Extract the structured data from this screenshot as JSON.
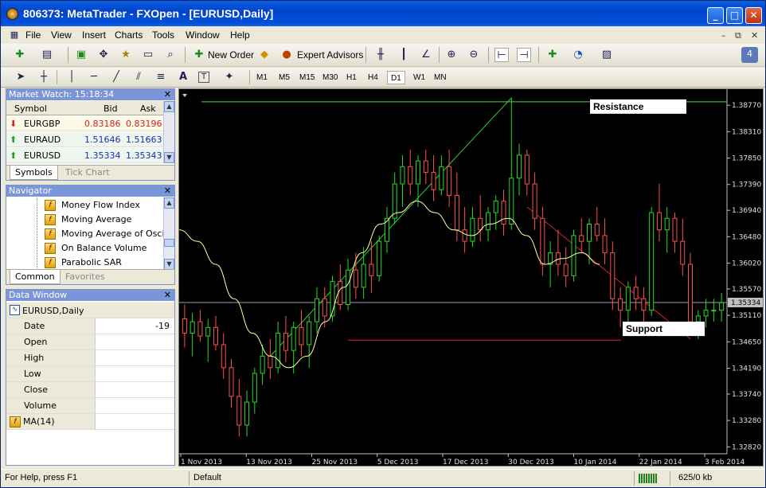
{
  "window": {
    "title": "806373: MetaTrader - FXOpen - [EURUSD,Daily]",
    "icon": "metatrader-app-icon"
  },
  "menu": [
    "File",
    "View",
    "Insert",
    "Charts",
    "Tools",
    "Window",
    "Help"
  ],
  "toolbar": {
    "new_order": "New Order",
    "expert_advisors": "Expert Advisors",
    "notification_count": "4"
  },
  "timeframes": [
    "M1",
    "M5",
    "M15",
    "M30",
    "H1",
    "H4",
    "D1",
    "W1",
    "MN"
  ],
  "selected_timeframe": "D1",
  "market_watch": {
    "title": "Market Watch: 15:18:34",
    "headers": [
      "Symbol",
      "Bid",
      "Ask"
    ],
    "rows": [
      {
        "symbol": "EURGBP",
        "bid": "0.83186",
        "ask": "0.83196",
        "dir": "down"
      },
      {
        "symbol": "EURAUD",
        "bid": "1.51646",
        "ask": "1.51663",
        "dir": "up"
      },
      {
        "symbol": "EURUSD",
        "bid": "1.35334",
        "ask": "1.35343",
        "dir": "up"
      }
    ],
    "tabs": [
      "Symbols",
      "Tick Chart"
    ]
  },
  "navigator": {
    "title": "Navigator",
    "items": [
      "Money Flow Index",
      "Moving Average",
      "Moving Average of Oscilla",
      "On Balance Volume",
      "Parabolic SAR"
    ],
    "tabs": [
      "Common",
      "Favorites"
    ]
  },
  "data_window": {
    "title": "Data Window",
    "symbol": "EURUSD,Daily",
    "rows": [
      {
        "label": "Date",
        "value": "-19"
      },
      {
        "label": "Open",
        "value": ""
      },
      {
        "label": "High",
        "value": ""
      },
      {
        "label": "Low",
        "value": ""
      },
      {
        "label": "Close",
        "value": ""
      },
      {
        "label": "Volume",
        "value": ""
      }
    ],
    "indicator": "MA(14)"
  },
  "chart_data": {
    "type": "candlestick",
    "symbol": "EURUSD",
    "timeframe": "Daily",
    "price_ticks": [
      "1.38770",
      "1.38310",
      "1.37850",
      "1.37390",
      "1.36940",
      "1.36480",
      "1.36020",
      "1.35570",
      "1.35110",
      "1.34650",
      "1.34190",
      "1.33740",
      "1.33280",
      "1.32820"
    ],
    "current_price": "1.35334",
    "date_ticks": [
      "1 Nov 2013",
      "13 Nov 2013",
      "25 Nov 2013",
      "5 Dec 2013",
      "17 Dec 2013",
      "30 Dec 2013",
      "10 Jan 2014",
      "22 Jan 2014",
      "3 Feb 2014"
    ],
    "annotations": {
      "resistance": "Resistance",
      "support": "Support"
    },
    "resistance_level": 1.3883,
    "support_level": 1.3468,
    "ylim": [
      1.327,
      1.3905
    ],
    "colors": {
      "bull": "#22dd22",
      "bear": "#ff5050",
      "ma": "#ffffa0",
      "hline": "#3fdc3f",
      "support_line": "#dc1e3c",
      "grid": "#606060",
      "price_line": "#a0a0c0"
    },
    "candles": [
      [
        1.3505,
        1.353,
        1.3455,
        1.348
      ],
      [
        1.348,
        1.3515,
        1.344,
        1.35
      ],
      [
        1.35,
        1.352,
        1.3465,
        1.3475
      ],
      [
        1.3475,
        1.3505,
        1.343,
        1.349
      ],
      [
        1.349,
        1.351,
        1.345,
        1.346
      ],
      [
        1.346,
        1.348,
        1.34,
        1.342
      ],
      [
        1.342,
        1.3435,
        1.335,
        1.337
      ],
      [
        1.337,
        1.34,
        1.33,
        1.332
      ],
      [
        1.332,
        1.338,
        1.33,
        1.336
      ],
      [
        1.336,
        1.342,
        1.334,
        1.341
      ],
      [
        1.341,
        1.346,
        1.339,
        1.344
      ],
      [
        1.344,
        1.347,
        1.34,
        1.342
      ],
      [
        1.342,
        1.35,
        1.341,
        1.348
      ],
      [
        1.348,
        1.351,
        1.343,
        1.345
      ],
      [
        1.345,
        1.35,
        1.341,
        1.349
      ],
      [
        1.349,
        1.352,
        1.344,
        1.346
      ],
      [
        1.346,
        1.351,
        1.342,
        1.35
      ],
      [
        1.35,
        1.356,
        1.348,
        1.354
      ],
      [
        1.354,
        1.356,
        1.349,
        1.351
      ],
      [
        1.351,
        1.358,
        1.35,
        1.357
      ],
      [
        1.357,
        1.36,
        1.352,
        1.353
      ],
      [
        1.353,
        1.361,
        1.352,
        1.359
      ],
      [
        1.359,
        1.362,
        1.354,
        1.356
      ],
      [
        1.356,
        1.363,
        1.354,
        1.36
      ],
      [
        1.36,
        1.364,
        1.355,
        1.358
      ],
      [
        1.358,
        1.365,
        1.357,
        1.364
      ],
      [
        1.364,
        1.37,
        1.362,
        1.368
      ],
      [
        1.368,
        1.376,
        1.367,
        1.374
      ],
      [
        1.374,
        1.379,
        1.37,
        1.377
      ],
      [
        1.377,
        1.38,
        1.372,
        1.374
      ],
      [
        1.374,
        1.379,
        1.37,
        1.378
      ],
      [
        1.378,
        1.38,
        1.374,
        1.376
      ],
      [
        1.376,
        1.379,
        1.371,
        1.373
      ],
      [
        1.373,
        1.379,
        1.372,
        1.377
      ],
      [
        1.377,
        1.38,
        1.37,
        1.372
      ],
      [
        1.372,
        1.376,
        1.364,
        1.366
      ],
      [
        1.366,
        1.37,
        1.362,
        1.364
      ],
      [
        1.364,
        1.37,
        1.363,
        1.368
      ],
      [
        1.368,
        1.372,
        1.364,
        1.366
      ],
      [
        1.366,
        1.37,
        1.364,
        1.369
      ],
      [
        1.369,
        1.372,
        1.366,
        1.371
      ],
      [
        1.371,
        1.373,
        1.365,
        1.367
      ],
      [
        1.367,
        1.389,
        1.366,
        1.375
      ],
      [
        1.375,
        1.381,
        1.372,
        1.379
      ],
      [
        1.379,
        1.38,
        1.372,
        1.374
      ],
      [
        1.374,
        1.376,
        1.366,
        1.368
      ],
      [
        1.368,
        1.37,
        1.358,
        1.36
      ],
      [
        1.36,
        1.364,
        1.356,
        1.362
      ],
      [
        1.362,
        1.366,
        1.358,
        1.36
      ],
      [
        1.36,
        1.363,
        1.356,
        1.358
      ],
      [
        1.358,
        1.366,
        1.357,
        1.365
      ],
      [
        1.365,
        1.368,
        1.362,
        1.364
      ],
      [
        1.364,
        1.368,
        1.36,
        1.367
      ],
      [
        1.367,
        1.37,
        1.364,
        1.365
      ],
      [
        1.365,
        1.368,
        1.36,
        1.362
      ],
      [
        1.362,
        1.364,
        1.352,
        1.354
      ],
      [
        1.354,
        1.356,
        1.349,
        1.352
      ],
      [
        1.352,
        1.357,
        1.35,
        1.356
      ],
      [
        1.356,
        1.358,
        1.352,
        1.354
      ],
      [
        1.354,
        1.356,
        1.35,
        1.352
      ],
      [
        1.352,
        1.37,
        1.351,
        1.369
      ],
      [
        1.369,
        1.374,
        1.364,
        1.366
      ],
      [
        1.366,
        1.37,
        1.362,
        1.368
      ],
      [
        1.368,
        1.369,
        1.362,
        1.364
      ],
      [
        1.364,
        1.368,
        1.358,
        1.36
      ],
      [
        1.36,
        1.362,
        1.348,
        1.35
      ],
      [
        1.35,
        1.352,
        1.347,
        1.351
      ],
      [
        1.351,
        1.354,
        1.349,
        1.352
      ],
      [
        1.352,
        1.354,
        1.35,
        1.352
      ],
      [
        1.352,
        1.355,
        1.35,
        1.3533
      ]
    ],
    "ma": [
      1.366,
      1.364,
      1.36,
      1.354,
      1.348,
      1.344,
      1.342,
      1.344,
      1.35,
      1.356,
      1.362,
      1.367,
      1.369,
      1.371,
      1.369,
      1.366,
      1.365,
      1.367,
      1.368,
      1.365,
      1.36,
      1.361,
      1.362,
      1.36
    ]
  }
}
